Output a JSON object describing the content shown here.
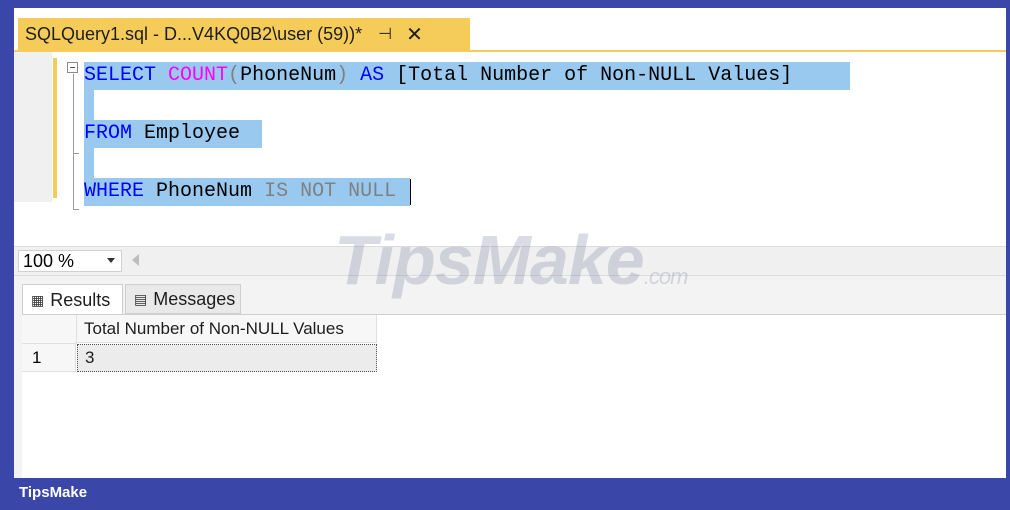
{
  "tab": {
    "title": "SQLQuery1.sql - D...V4KQ0B2\\user (59))*",
    "pin_icon": "pin-icon",
    "close_icon": "close-icon"
  },
  "editor": {
    "line1": {
      "kw1": "SELECT",
      "fn": "COUNT",
      "open": "(",
      "arg": "PhoneNum",
      "close": ")",
      "as": "AS",
      "alias": "[Total Number of Non-NULL Values]"
    },
    "line2": {
      "kw": "FROM",
      "table": "Employee"
    },
    "line3": {
      "kw": "WHERE",
      "col": "PhoneNum",
      "op": "IS NOT NULL"
    }
  },
  "zoom": {
    "value": "100 %"
  },
  "results_tabs": [
    {
      "label": "Results",
      "icon": "grid-icon"
    },
    {
      "label": "Messages",
      "icon": "message-icon"
    }
  ],
  "grid": {
    "columns": [
      "Total Number of Non-NULL Values"
    ],
    "rows": [
      {
        "num": "1",
        "values": [
          "3"
        ]
      }
    ]
  },
  "watermark": {
    "text": "TipsMake",
    "suffix": ".com"
  },
  "footer": {
    "brand": "TipsMake"
  },
  "colors": {
    "tab_accent": "#f5cc5a",
    "frame": "#3b47a8",
    "selection": "#99c9ef",
    "keyword": "#0000ff",
    "function": "#ff00ff"
  }
}
